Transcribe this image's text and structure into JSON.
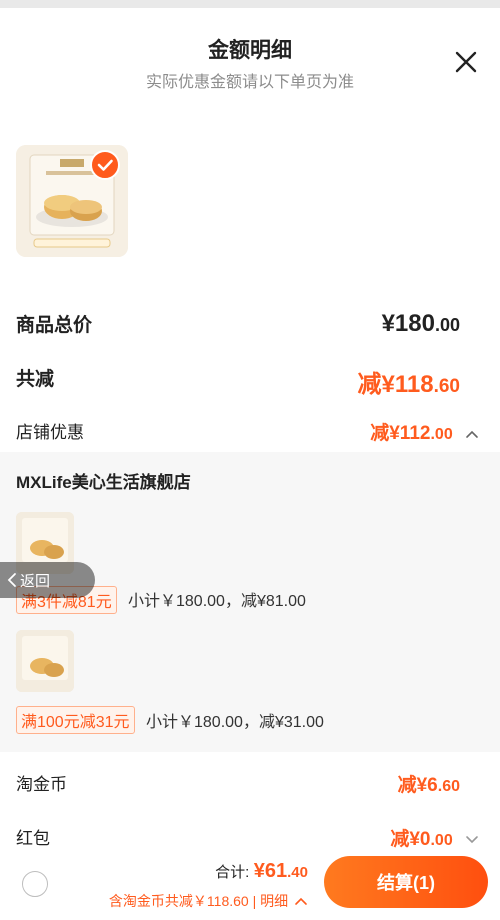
{
  "header": {
    "title": "金额明细",
    "subtitle": "实际优惠金额请以下单页为准"
  },
  "summary": {
    "total_label": "商品总价",
    "total_value": "¥180",
    "total_decimals": ".00",
    "discount_label": "共减",
    "discount_value": "减¥118",
    "discount_decimals": ".60",
    "store_label": "店铺优惠",
    "store_value": "减¥112",
    "store_decimals": ".00"
  },
  "store": {
    "name": "MXLife美心生活旗舰店",
    "promotions": [
      {
        "tag": "满3件减81元",
        "text": "小计￥180.00，减¥81.00"
      },
      {
        "tag": "满100元减31元",
        "text": "小计￥180.00，减¥31.00"
      }
    ]
  },
  "coins": {
    "label": "淘金币",
    "value": "减¥6",
    "decimals": ".60"
  },
  "red_packet": {
    "label": "红包",
    "value": "减¥0",
    "decimals": ".00"
  },
  "overlay": {
    "back_label": "返回"
  },
  "footer": {
    "sum_label": "合计:",
    "sum_value": "¥61",
    "sum_decimals": ".40",
    "detail_text": "含淘金币共减￥118.60 | 明细",
    "checkout_label": "结算(1)"
  },
  "colors": {
    "accent": "#ff5b1e",
    "panel_bg": "#f7f7f7"
  },
  "icons": [
    "close-icon",
    "check-icon",
    "chevron-up-icon",
    "chevron-down-icon",
    "back-chevron-icon"
  ]
}
